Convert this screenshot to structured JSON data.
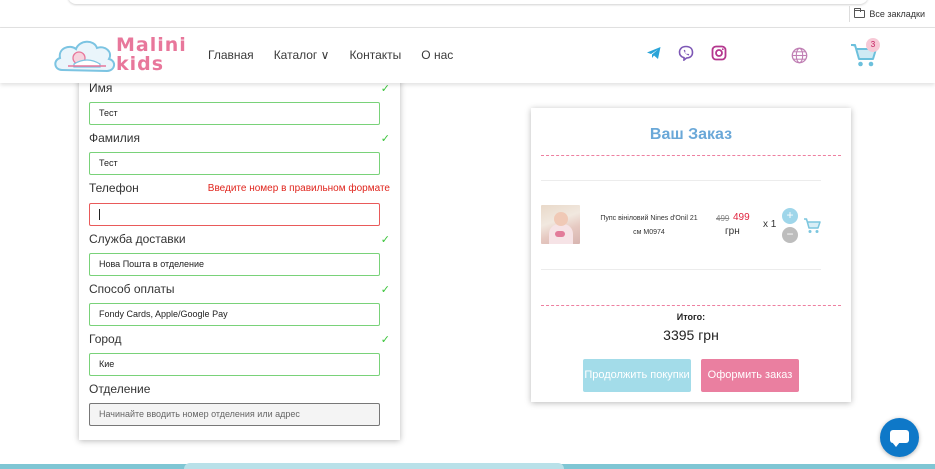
{
  "browser": {
    "bookmarks_all": "Все закладки"
  },
  "header": {
    "logo_text_1": "Malini",
    "logo_text_2": "kids",
    "nav": [
      {
        "label": "Главная"
      },
      {
        "label": "Каталог ∨"
      },
      {
        "label": "Контакты"
      },
      {
        "label": "О нас"
      }
    ],
    "cart_count": "3",
    "icons": [
      "telegram-icon",
      "viber-icon",
      "instagram-icon",
      "globe-icon",
      "cart-icon"
    ],
    "colors": {
      "brand_pink": "#e8779b",
      "brand_blue": "#6aa8d8",
      "telegram": "#2aa4d8",
      "viber": "#7d57b5",
      "instagram": "#b4368e"
    }
  },
  "form": {
    "fields": [
      {
        "label": "Имя",
        "value": "Тест",
        "status": "✓"
      },
      {
        "label": "Фамилия",
        "value": "Тест",
        "status": "✓"
      },
      {
        "label": "Телефон",
        "value": "",
        "error": "Введите номер в правильном формате"
      },
      {
        "label": "Служба доставки",
        "value": "Нова Пошта в отделение",
        "status": "✓"
      },
      {
        "label": "Способ оплаты",
        "value": "Fondy Cards, Apple/Google Pay",
        "status": "✓"
      },
      {
        "label": "Город",
        "value": "Кие",
        "status": "✓"
      },
      {
        "label": "Отделение",
        "placeholder": "Начинайте вводить номер отделения или адрес"
      }
    ],
    "colors": {
      "valid": "#79d279",
      "error": "#e0251d"
    }
  },
  "order": {
    "title": "Ваш Заказ",
    "item": {
      "name": "Пупс вініловий Nines d'Onil 21 см M0974",
      "price_old": "499",
      "price_new": "499",
      "currency": "грн",
      "qty": "x 1",
      "plus": "+",
      "minus": "−"
    },
    "total_label": "Итого:",
    "total_value": "3395 грн",
    "btn_continue": "Продолжить покупки",
    "btn_checkout": "Оформить заказ",
    "colors": {
      "continue": "#a3dce9",
      "checkout": "#ea7fa0",
      "price_new": "#e0253f"
    }
  }
}
